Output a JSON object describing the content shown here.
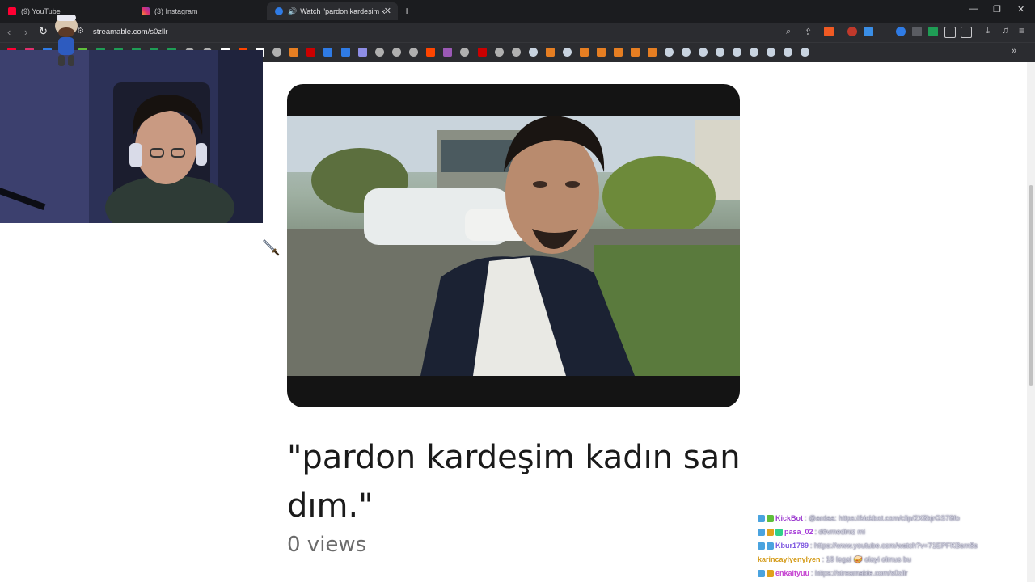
{
  "browser": {
    "tabs": [
      {
        "label": "(9) YouTube",
        "favicon": "youtube-icon",
        "color": "#ff0033"
      },
      {
        "label": "(3) Instagram",
        "favicon": "instagram-icon",
        "color": "#e1306c"
      },
      {
        "label": "Watch \"pardon kardeşim kad",
        "favicon": "streamable-icon",
        "color": "#2f7be5",
        "active": true
      }
    ],
    "new_tab": "+",
    "window_controls": [
      "—",
      "❐",
      "✕"
    ],
    "url": "streamable.com/s0zllr"
  },
  "video": {
    "title": "\"pardon kardeşim kadın san dım.\"",
    "views": "0 views"
  },
  "chat": [
    {
      "user": "KickBot",
      "user_color": "#9e3fd0",
      "message": ": @ardaa: https://kickbot.com/clip/2X8bjrGS78fo",
      "badges": [
        "#4aa3df",
        "#5fbf3b"
      ]
    },
    {
      "user": "pasa_02",
      "user_color": "#a63fd8",
      "message": ": dövmediniz mi",
      "badges": [
        "#4aa3df",
        "#e0a21d",
        "#2fd08a"
      ]
    },
    {
      "user": "Kbur1789",
      "user_color": "#7d56e0",
      "message": ": https://www.youtube.com/watch?v=71EPFKBsm8s",
      "badges": [
        "#4aa3df",
        "#4aa3df"
      ]
    },
    {
      "user": "karincaylyenylyen",
      "user_color": "#d49b18",
      "message": ": 19 legal 🥪 olayi olmus bu",
      "badges": []
    },
    {
      "user": "enkaltyuu",
      "user_color": "#c43fd0",
      "message": ": https://streamable.com/s0zllr",
      "badges": [
        "#4aa3df",
        "#e0a21d"
      ]
    }
  ],
  "colors": {
    "chrome_bg": "#2b2c30",
    "page_bg": "#ffffff",
    "title_text": "#1a1a1a",
    "views_text": "#6b6b6b"
  }
}
